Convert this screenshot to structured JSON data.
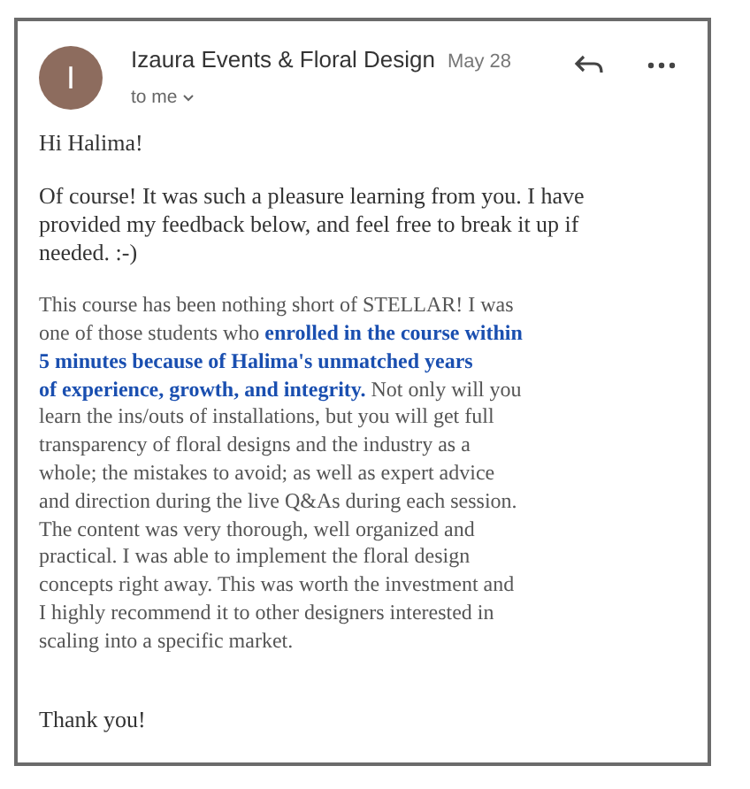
{
  "sender": {
    "avatar_letter": "I",
    "name": "Izaura Events & Floral Design",
    "date": "May 28",
    "recipient": "to me"
  },
  "greeting": "Hi Halima!",
  "intro_lines": [
    "Of course! It was such a pleasure learning from you. I have",
    "provided my feedback below, and feel free to break it up if",
    "needed. :-)"
  ],
  "quote_lines": [
    "This course has been nothing short of STELLAR! I was",
    "one of those students who **enrolled in the course within**",
    "**5 minutes because of Halima's unmatched years**",
    "**of experience, growth, and integrity.** Not only will you",
    "learn the ins/outs of installations, but you will get full",
    "transparency of floral designs and the industry as a",
    "whole; the mistakes to avoid; as well as expert advice",
    "and direction during the live Q&As during each session.",
    "The content was very thorough, well organized and",
    "practical. I was able to implement the floral design",
    "concepts right away. This was worth the investment and",
    "I highly recommend it to other designers interested in",
    "scaling into a specific market."
  ],
  "closing": "Thank you!"
}
